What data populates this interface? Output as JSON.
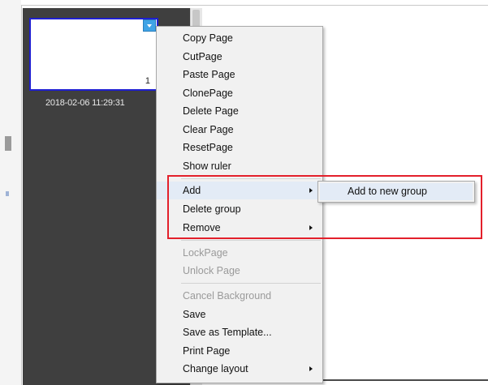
{
  "thumbnail": {
    "page_number": "1",
    "timestamp": "2018-02-06 11:29:31"
  },
  "context_menu": {
    "items": [
      {
        "label": "Copy Page",
        "enabled": true
      },
      {
        "label": "CutPage",
        "enabled": true
      },
      {
        "label": "Paste Page",
        "enabled": true
      },
      {
        "label": "ClonePage",
        "enabled": true
      },
      {
        "label": "Delete Page",
        "enabled": true
      },
      {
        "label": "Clear Page",
        "enabled": true
      },
      {
        "label": "ResetPage",
        "enabled": true
      },
      {
        "label": "Show ruler",
        "enabled": true
      },
      {
        "label": "Add",
        "enabled": true,
        "has_submenu": true,
        "highlighted": true
      },
      {
        "label": "Delete group",
        "enabled": true
      },
      {
        "label": "Remove",
        "enabled": true,
        "has_submenu": true
      },
      {
        "label": "LockPage",
        "enabled": false
      },
      {
        "label": "Unlock Page",
        "enabled": false
      },
      {
        "label": "Cancel Background",
        "enabled": false
      },
      {
        "label": "Save",
        "enabled": true
      },
      {
        "label": "Save as Template...",
        "enabled": true
      },
      {
        "label": "Print Page",
        "enabled": true
      },
      {
        "label": "Change layout",
        "enabled": true,
        "has_submenu": true
      }
    ]
  },
  "submenu": {
    "items": [
      {
        "label": "Add to new group",
        "highlighted": true
      }
    ]
  },
  "colors": {
    "panel_background": "#3f3f3f",
    "menu_background": "#f1f1f1",
    "menu_highlight": "#e3ebf6",
    "thumbnail_border": "#1f1fd0",
    "dropdown_button": "#3fa3e6",
    "annotation_box": "#e3202b",
    "disabled_text": "#9a9a9a"
  }
}
